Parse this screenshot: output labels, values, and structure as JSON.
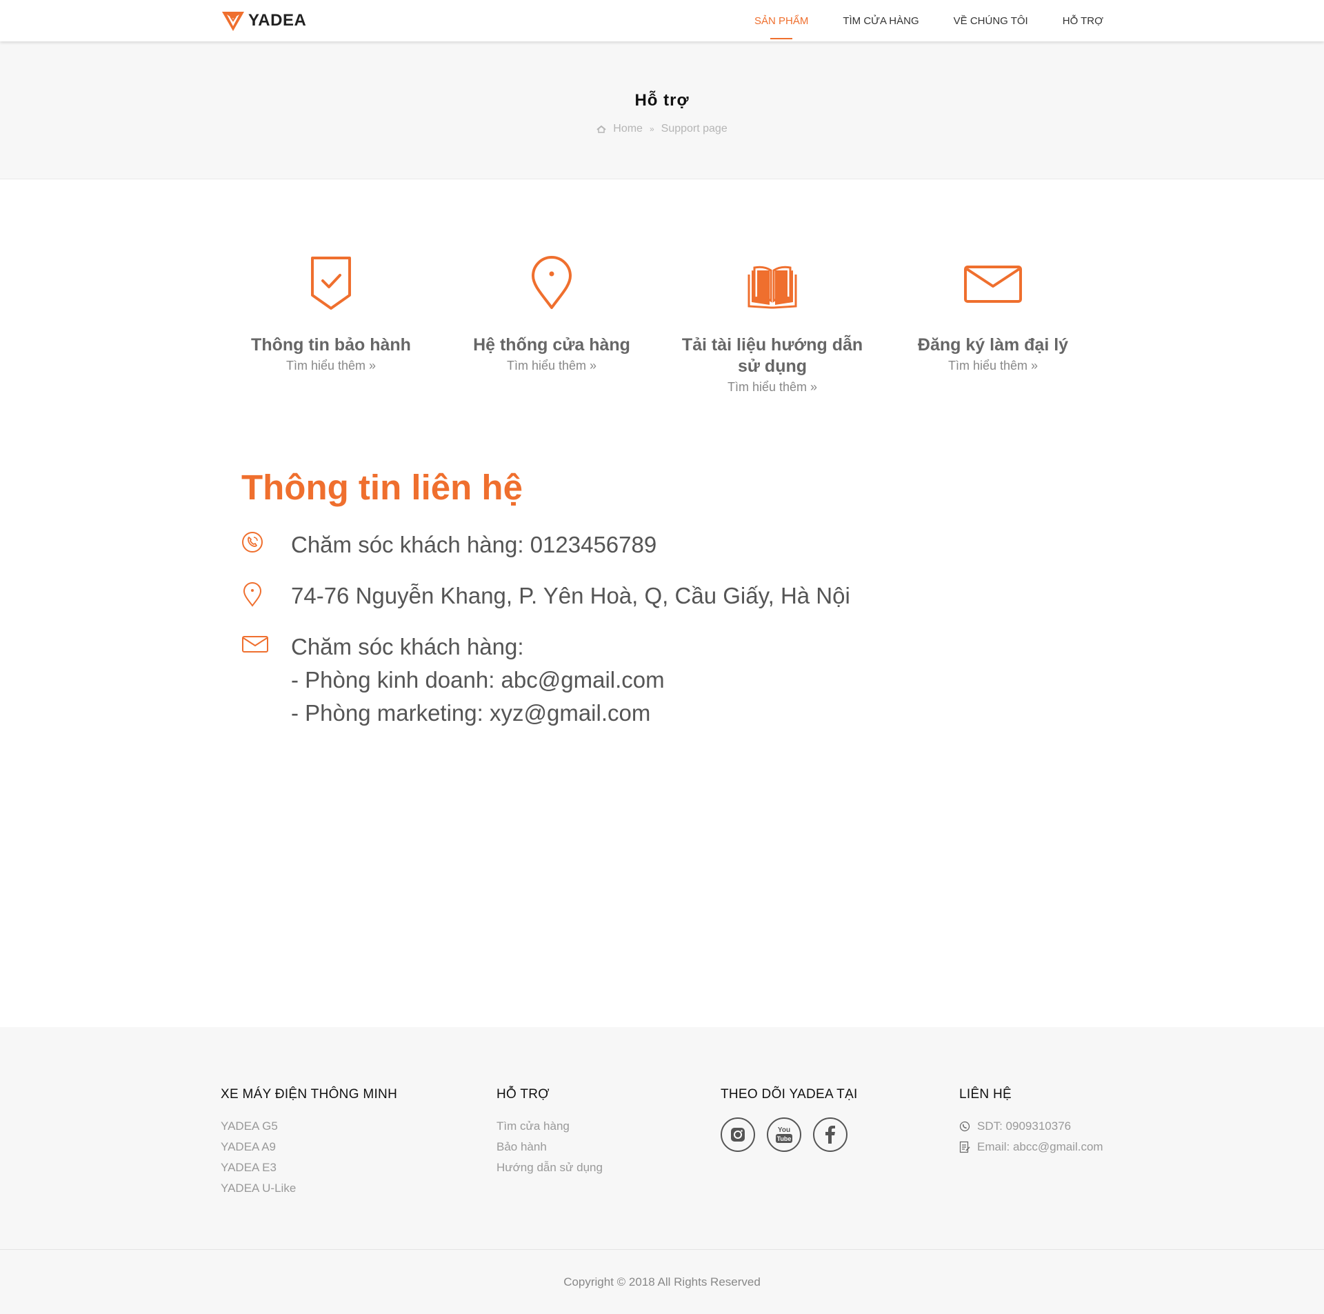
{
  "header": {
    "brand": "YADEA",
    "nav": [
      {
        "label": "SẢN PHẨM"
      },
      {
        "label": "TÌM CỬA HÀNG"
      },
      {
        "label": "VỀ CHÚNG TÔI"
      },
      {
        "label": "HỖ TRỢ"
      }
    ]
  },
  "banner": {
    "title": "Hỗ trợ",
    "breadcrumb": {
      "home": "Home",
      "separator": "»",
      "current": "Support page"
    }
  },
  "features": [
    {
      "icon": "shield-check-icon",
      "title": "Thông tin bảo hành",
      "link": "Tìm hiểu thêm »"
    },
    {
      "icon": "map-pin-icon",
      "title": "Hệ thống cửa hàng",
      "link": "Tìm hiểu thêm »"
    },
    {
      "icon": "book-icon",
      "title": "Tải tài liệu hướng dẫn sử dụng",
      "link": "Tìm hiểu thêm »"
    },
    {
      "icon": "envelope-icon",
      "title": "Đăng ký làm đại lý",
      "link": "Tìm hiểu thêm »"
    }
  ],
  "contact": {
    "title": "Thông tin liên hệ",
    "phone": "Chăm sóc khách hàng: 0123456789",
    "address": "74-76 Nguyễn Khang, P. Yên Hoà, Q, Cầu Giấy, Hà Nội",
    "email_heading": "Chăm sóc khách hàng:",
    "email_sales": "- Phòng kinh doanh: abc@gmail.com",
    "email_marketing": "- Phòng marketing: xyz@gmail.com"
  },
  "footer": {
    "col1": {
      "title": "XE MÁY ĐIỆN THÔNG MINH",
      "items": [
        "YADEA G5",
        "YADEA A9",
        "YADEA E3",
        "YADEA U-Like"
      ]
    },
    "col2": {
      "title": "HỖ TRỢ",
      "items": [
        "Tìm cửa hàng",
        "Bảo hành",
        "Hướng dẫn sử dụng"
      ]
    },
    "col3": {
      "title": "THEO DÕI YADEA TẠI",
      "socials": [
        "instagram-icon",
        "youtube-icon",
        "facebook-icon"
      ]
    },
    "col4": {
      "title": "LIÊN HỆ",
      "phone": "SDT: 0909310376",
      "email": "Email: abcc@gmail.com"
    },
    "copyright": "Copyright © 2018 All Rights Reserved"
  },
  "colors": {
    "accent": "#ef6f2e",
    "banner_bg": "#f7f7f7",
    "text": "#555555"
  }
}
